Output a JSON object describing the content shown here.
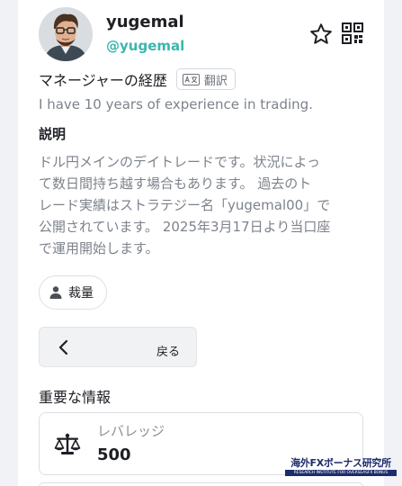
{
  "profile": {
    "username": "yugemal",
    "handle": "@yugemal",
    "avatar_icon": "avatar-portrait",
    "actions": {
      "favorite_icon": "star-outline-icon",
      "qr_icon": "qr-code-icon"
    }
  },
  "manager_history": {
    "title": "マネージャーの経歴",
    "translate_label": "翻訳",
    "translate_icon": "translate-icon",
    "text": "I have 10 years of experience in trading."
  },
  "description": {
    "label": "説明",
    "lines": [
      "ドル円メインのデイトレードです。状況によっ",
      "て数日間持ち越す場合もあります。 過去のト",
      "レード実績はストラテジー名「yugemal00」で",
      "公開されています。 2025年3月17日より当口座",
      "で運用開始します。"
    ]
  },
  "tag": {
    "label": "裁量",
    "icon": "person-icon"
  },
  "back_button": {
    "label": "戻る",
    "icon": "chevron-left-icon"
  },
  "important_info": {
    "heading": "重要な情報",
    "leverage_label": "レバレッジ",
    "leverage_value": "500",
    "leverage_icon": "scale-icon"
  },
  "watermark": {
    "title": "海外FXボーナス研究所",
    "subtitle": "RESEARCH INSTITUTE FOR OVERSEASFX BONUS"
  },
  "colors": {
    "accent": "#3bb6ae",
    "muted_text": "#7d838c",
    "text": "#1d1f24",
    "border": "#dcdfe3",
    "watermark_navy": "#1d2c6b"
  }
}
